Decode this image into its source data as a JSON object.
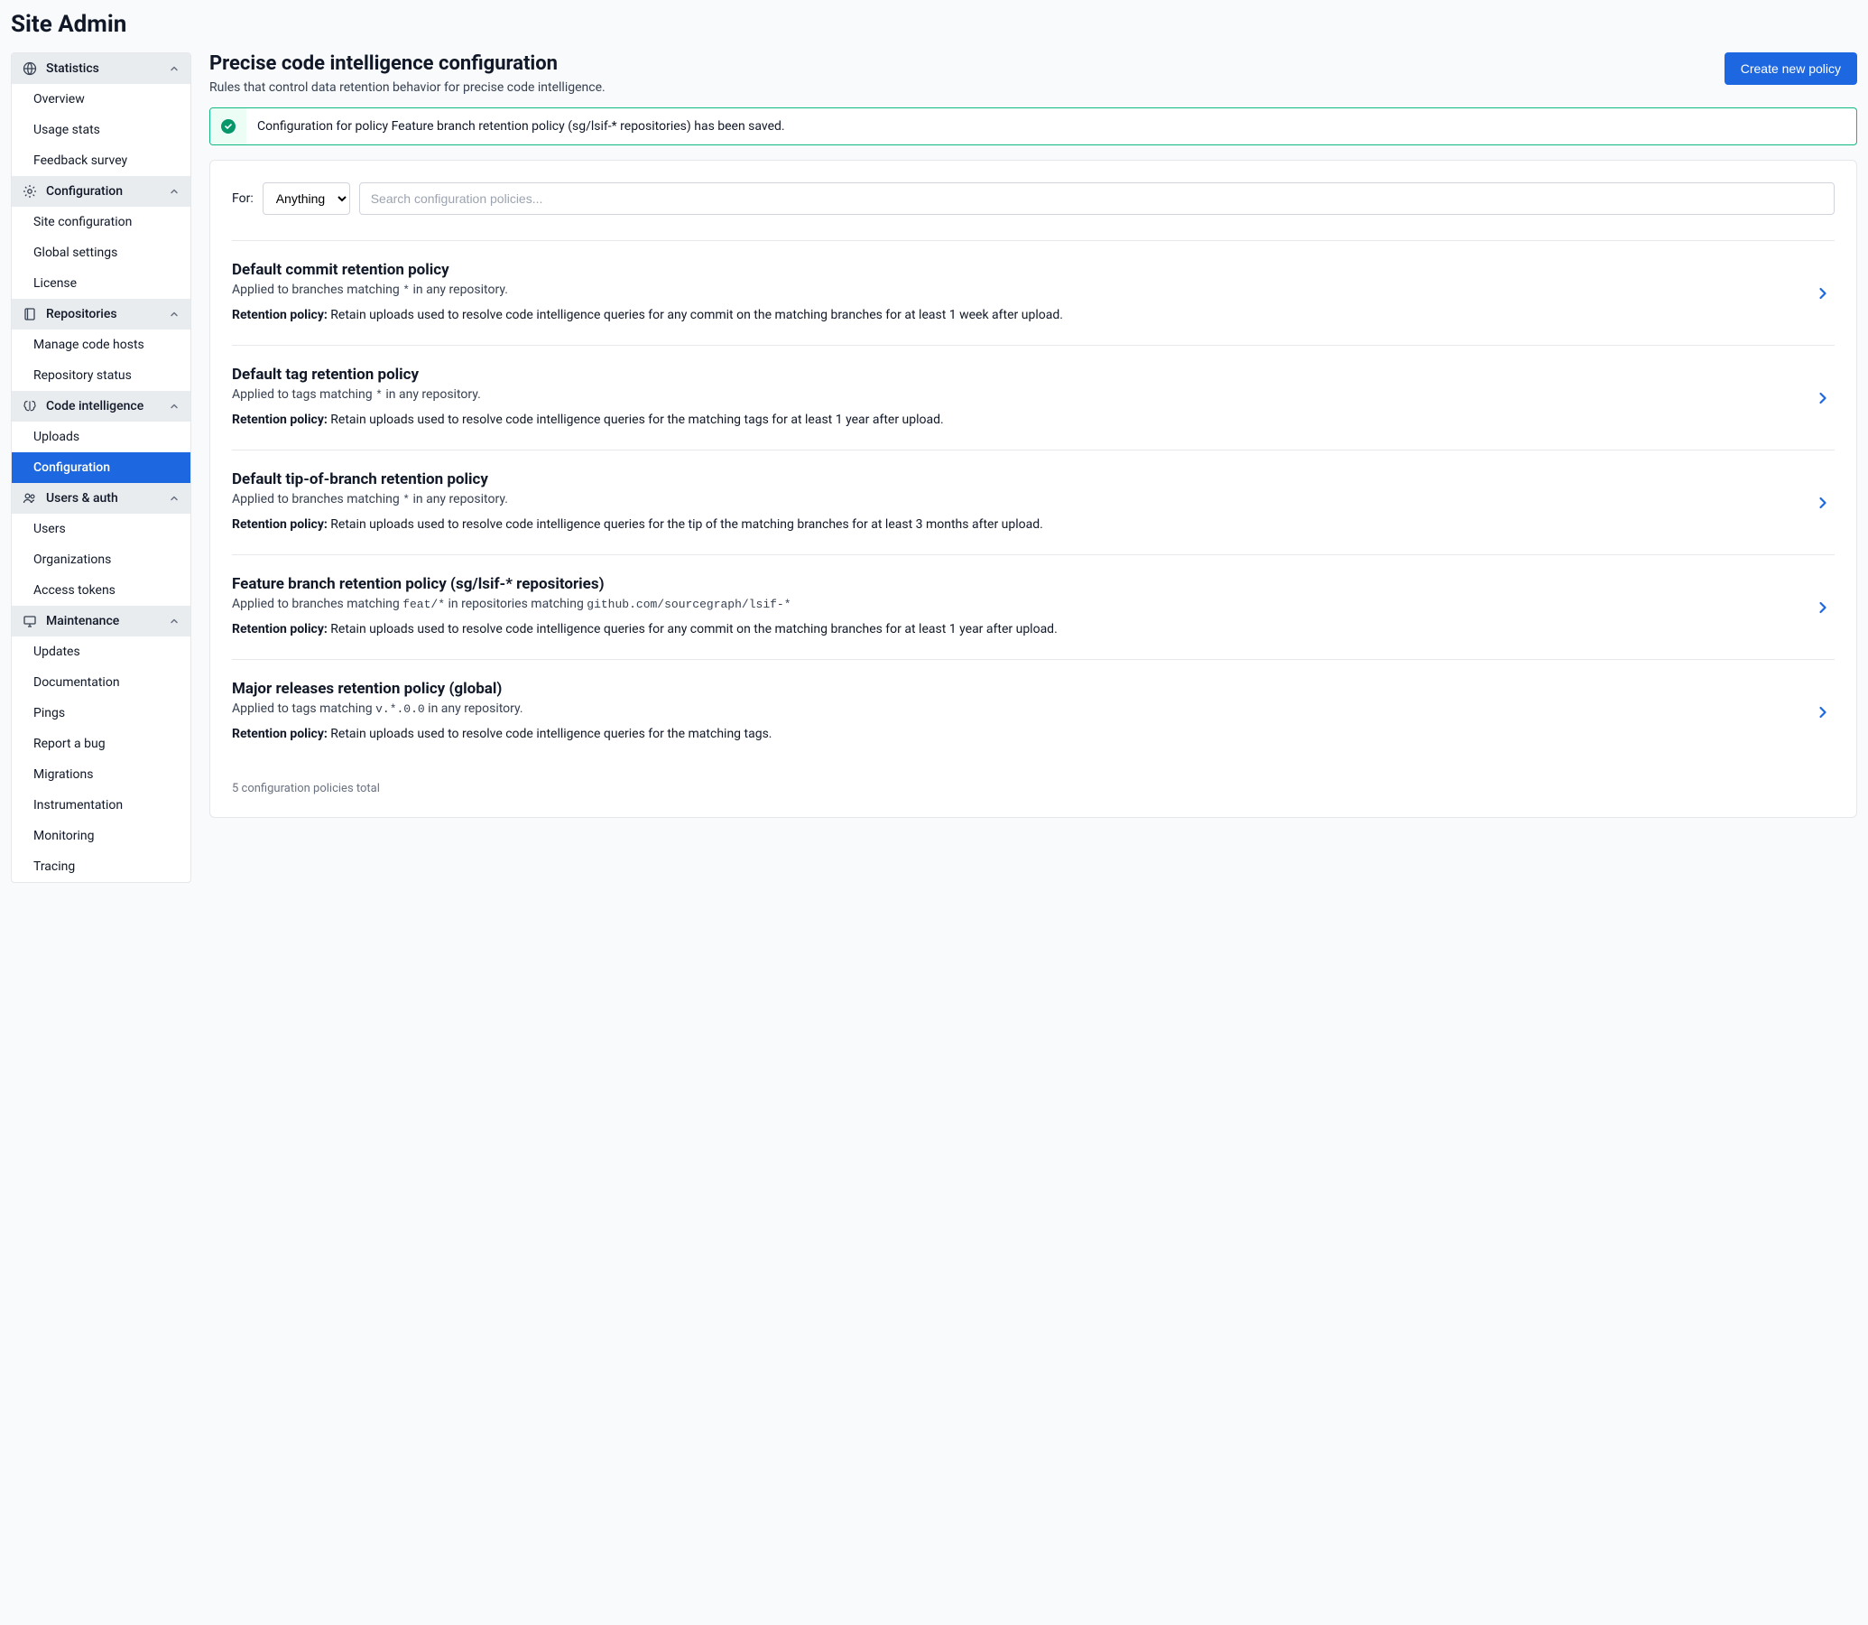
{
  "page_title": "Site Admin",
  "sidebar": {
    "groups": [
      {
        "key": "statistics",
        "label": "Statistics",
        "icon": "globe-icon",
        "items": [
          {
            "key": "overview",
            "label": "Overview"
          },
          {
            "key": "usage-stats",
            "label": "Usage stats"
          },
          {
            "key": "feedback-survey",
            "label": "Feedback survey"
          }
        ]
      },
      {
        "key": "configuration",
        "label": "Configuration",
        "icon": "gear-icon",
        "items": [
          {
            "key": "site-config",
            "label": "Site configuration"
          },
          {
            "key": "global-settings",
            "label": "Global settings"
          },
          {
            "key": "license",
            "label": "License"
          }
        ]
      },
      {
        "key": "repositories",
        "label": "Repositories",
        "icon": "repo-icon",
        "items": [
          {
            "key": "manage-code-hosts",
            "label": "Manage code hosts"
          },
          {
            "key": "repository-status",
            "label": "Repository status"
          }
        ]
      },
      {
        "key": "code-intelligence",
        "label": "Code intelligence",
        "icon": "brain-icon",
        "items": [
          {
            "key": "uploads",
            "label": "Uploads"
          },
          {
            "key": "ci-configuration",
            "label": "Configuration",
            "active": true
          }
        ]
      },
      {
        "key": "users-auth",
        "label": "Users & auth",
        "icon": "users-icon",
        "items": [
          {
            "key": "users",
            "label": "Users"
          },
          {
            "key": "organizations",
            "label": "Organizations"
          },
          {
            "key": "access-tokens",
            "label": "Access tokens"
          }
        ]
      },
      {
        "key": "maintenance",
        "label": "Maintenance",
        "icon": "monitor-icon",
        "items": [
          {
            "key": "updates",
            "label": "Updates"
          },
          {
            "key": "documentation",
            "label": "Documentation"
          },
          {
            "key": "pings",
            "label": "Pings"
          },
          {
            "key": "report-bug",
            "label": "Report a bug"
          },
          {
            "key": "migrations",
            "label": "Migrations"
          },
          {
            "key": "instrumentation",
            "label": "Instrumentation"
          },
          {
            "key": "monitoring",
            "label": "Monitoring"
          },
          {
            "key": "tracing",
            "label": "Tracing"
          }
        ]
      }
    ]
  },
  "main": {
    "title": "Precise code intelligence configuration",
    "subtitle": "Rules that control data retention behavior for precise code intelligence.",
    "create_button": "Create new policy"
  },
  "alert": {
    "message": "Configuration for policy Feature branch retention policy (sg/lsif-* repositories) has been saved."
  },
  "filter": {
    "for_label": "For:",
    "selected": "Anything",
    "search_placeholder": "Search configuration policies..."
  },
  "policies": [
    {
      "title": "Default commit retention policy",
      "applied_prefix": "Applied to branches matching ",
      "applied_pattern": "*",
      "applied_suffix": " in any repository.",
      "retention_label": "Retention policy:",
      "retention_text": " Retain uploads used to resolve code intelligence queries for any commit on the matching branches for at least 1 week after upload."
    },
    {
      "title": "Default tag retention policy",
      "applied_prefix": "Applied to tags matching ",
      "applied_pattern": "*",
      "applied_suffix": " in any repository.",
      "retention_label": "Retention policy:",
      "retention_text": " Retain uploads used to resolve code intelligence queries for the matching tags for at least 1 year after upload."
    },
    {
      "title": "Default tip-of-branch retention policy",
      "applied_prefix": "Applied to branches matching ",
      "applied_pattern": "*",
      "applied_suffix": " in any repository.",
      "retention_label": "Retention policy:",
      "retention_text": " Retain uploads used to resolve code intelligence queries for the tip of the matching branches for at least 3 months after upload."
    },
    {
      "title": "Feature branch retention policy (sg/lsif-* repositories)",
      "applied_prefix": "Applied to branches matching ",
      "applied_pattern": "feat/*",
      "applied_middle": " in repositories matching ",
      "applied_pattern2": "github.com/sourcegraph/lsif-*",
      "applied_suffix": "",
      "retention_label": "Retention policy:",
      "retention_text": " Retain uploads used to resolve code intelligence queries for any commit on the matching branches for at least 1 year after upload."
    },
    {
      "title": "Major releases retention policy (global)",
      "applied_prefix": "Applied to tags matching ",
      "applied_pattern": "v.*.0.0",
      "applied_suffix": " in any repository.",
      "retention_label": "Retention policy:",
      "retention_text": " Retain uploads used to resolve code intelligence queries for the matching tags."
    }
  ],
  "total_text": "5 configuration policies total"
}
